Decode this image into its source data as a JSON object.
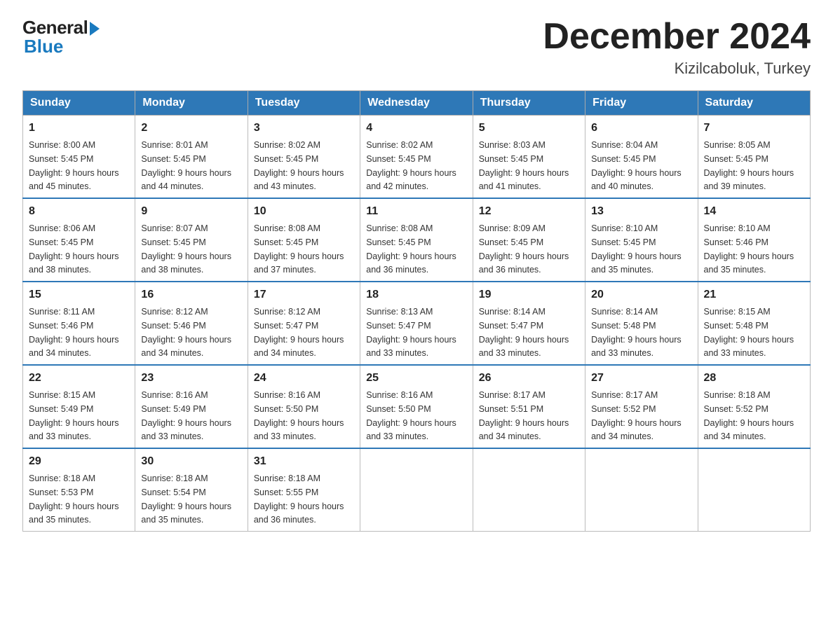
{
  "header": {
    "logo_general": "General",
    "logo_blue": "Blue",
    "title": "December 2024",
    "location": "Kizilcaboluk, Turkey"
  },
  "days_of_week": [
    "Sunday",
    "Monday",
    "Tuesday",
    "Wednesday",
    "Thursday",
    "Friday",
    "Saturday"
  ],
  "weeks": [
    [
      {
        "day": "1",
        "sunrise": "8:00 AM",
        "sunset": "5:45 PM",
        "daylight": "9 hours and 45 minutes."
      },
      {
        "day": "2",
        "sunrise": "8:01 AM",
        "sunset": "5:45 PM",
        "daylight": "9 hours and 44 minutes."
      },
      {
        "day": "3",
        "sunrise": "8:02 AM",
        "sunset": "5:45 PM",
        "daylight": "9 hours and 43 minutes."
      },
      {
        "day": "4",
        "sunrise": "8:02 AM",
        "sunset": "5:45 PM",
        "daylight": "9 hours and 42 minutes."
      },
      {
        "day": "5",
        "sunrise": "8:03 AM",
        "sunset": "5:45 PM",
        "daylight": "9 hours and 41 minutes."
      },
      {
        "day": "6",
        "sunrise": "8:04 AM",
        "sunset": "5:45 PM",
        "daylight": "9 hours and 40 minutes."
      },
      {
        "day": "7",
        "sunrise": "8:05 AM",
        "sunset": "5:45 PM",
        "daylight": "9 hours and 39 minutes."
      }
    ],
    [
      {
        "day": "8",
        "sunrise": "8:06 AM",
        "sunset": "5:45 PM",
        "daylight": "9 hours and 38 minutes."
      },
      {
        "day": "9",
        "sunrise": "8:07 AM",
        "sunset": "5:45 PM",
        "daylight": "9 hours and 38 minutes."
      },
      {
        "day": "10",
        "sunrise": "8:08 AM",
        "sunset": "5:45 PM",
        "daylight": "9 hours and 37 minutes."
      },
      {
        "day": "11",
        "sunrise": "8:08 AM",
        "sunset": "5:45 PM",
        "daylight": "9 hours and 36 minutes."
      },
      {
        "day": "12",
        "sunrise": "8:09 AM",
        "sunset": "5:45 PM",
        "daylight": "9 hours and 36 minutes."
      },
      {
        "day": "13",
        "sunrise": "8:10 AM",
        "sunset": "5:45 PM",
        "daylight": "9 hours and 35 minutes."
      },
      {
        "day": "14",
        "sunrise": "8:10 AM",
        "sunset": "5:46 PM",
        "daylight": "9 hours and 35 minutes."
      }
    ],
    [
      {
        "day": "15",
        "sunrise": "8:11 AM",
        "sunset": "5:46 PM",
        "daylight": "9 hours and 34 minutes."
      },
      {
        "day": "16",
        "sunrise": "8:12 AM",
        "sunset": "5:46 PM",
        "daylight": "9 hours and 34 minutes."
      },
      {
        "day": "17",
        "sunrise": "8:12 AM",
        "sunset": "5:47 PM",
        "daylight": "9 hours and 34 minutes."
      },
      {
        "day": "18",
        "sunrise": "8:13 AM",
        "sunset": "5:47 PM",
        "daylight": "9 hours and 33 minutes."
      },
      {
        "day": "19",
        "sunrise": "8:14 AM",
        "sunset": "5:47 PM",
        "daylight": "9 hours and 33 minutes."
      },
      {
        "day": "20",
        "sunrise": "8:14 AM",
        "sunset": "5:48 PM",
        "daylight": "9 hours and 33 minutes."
      },
      {
        "day": "21",
        "sunrise": "8:15 AM",
        "sunset": "5:48 PM",
        "daylight": "9 hours and 33 minutes."
      }
    ],
    [
      {
        "day": "22",
        "sunrise": "8:15 AM",
        "sunset": "5:49 PM",
        "daylight": "9 hours and 33 minutes."
      },
      {
        "day": "23",
        "sunrise": "8:16 AM",
        "sunset": "5:49 PM",
        "daylight": "9 hours and 33 minutes."
      },
      {
        "day": "24",
        "sunrise": "8:16 AM",
        "sunset": "5:50 PM",
        "daylight": "9 hours and 33 minutes."
      },
      {
        "day": "25",
        "sunrise": "8:16 AM",
        "sunset": "5:50 PM",
        "daylight": "9 hours and 33 minutes."
      },
      {
        "day": "26",
        "sunrise": "8:17 AM",
        "sunset": "5:51 PM",
        "daylight": "9 hours and 34 minutes."
      },
      {
        "day": "27",
        "sunrise": "8:17 AM",
        "sunset": "5:52 PM",
        "daylight": "9 hours and 34 minutes."
      },
      {
        "day": "28",
        "sunrise": "8:18 AM",
        "sunset": "5:52 PM",
        "daylight": "9 hours and 34 minutes."
      }
    ],
    [
      {
        "day": "29",
        "sunrise": "8:18 AM",
        "sunset": "5:53 PM",
        "daylight": "9 hours and 35 minutes."
      },
      {
        "day": "30",
        "sunrise": "8:18 AM",
        "sunset": "5:54 PM",
        "daylight": "9 hours and 35 minutes."
      },
      {
        "day": "31",
        "sunrise": "8:18 AM",
        "sunset": "5:55 PM",
        "daylight": "9 hours and 36 minutes."
      },
      null,
      null,
      null,
      null
    ]
  ]
}
